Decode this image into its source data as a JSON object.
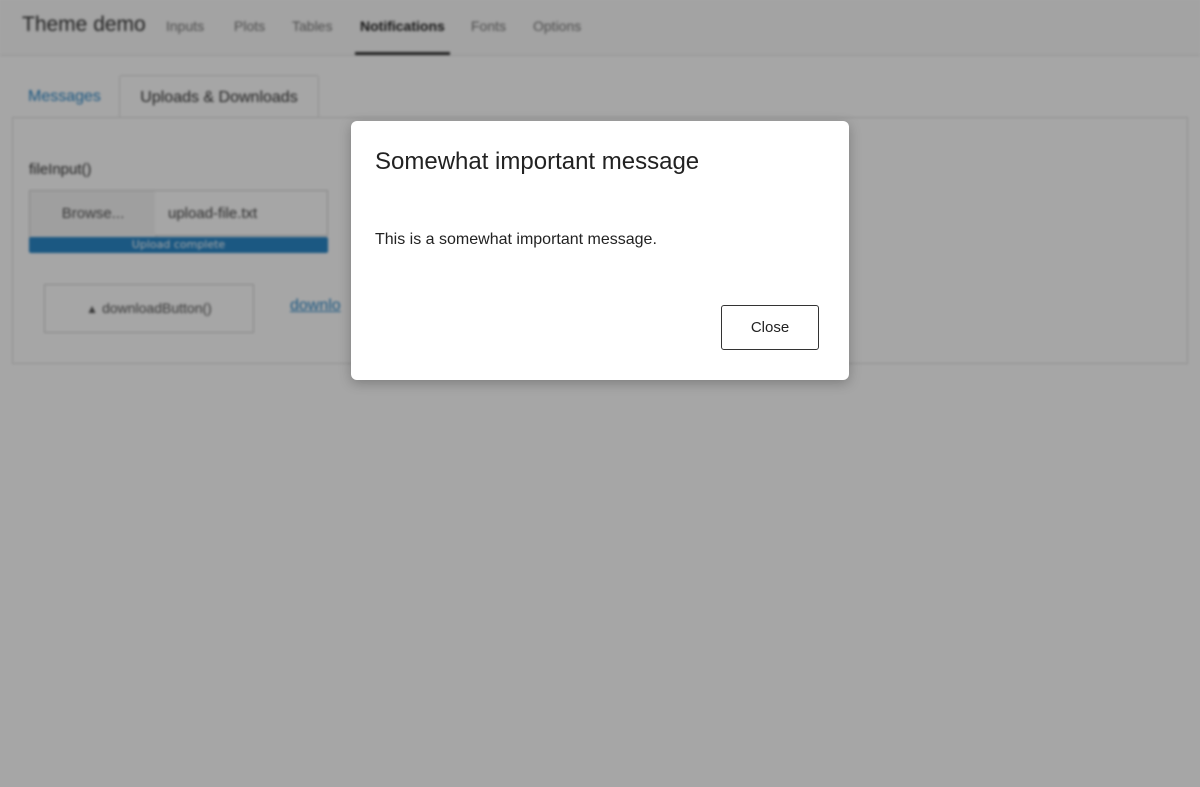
{
  "navbar": {
    "brand": "Theme demo",
    "items": [
      "Inputs",
      "Plots",
      "Tables",
      "Notifications",
      "Fonts",
      "Options"
    ],
    "active": "Notifications"
  },
  "subtabs": {
    "items": [
      "Messages",
      "Uploads & Downloads"
    ],
    "active": "Uploads & Downloads"
  },
  "upload": {
    "label": "fileInput()",
    "browse_label": "Browse...",
    "file_name": "upload-file.txt",
    "progress_text": "Upload complete",
    "progress_fraction": 1.0
  },
  "download": {
    "button_label": "downloadButton()",
    "link_text": "downlo"
  },
  "modal": {
    "title": "Somewhat important message",
    "body": "This is a somewhat important message.",
    "close_label": "Close"
  },
  "colors": {
    "accent": "#2a87c8",
    "backdrop": "rgba(0,0,0,0.35)"
  }
}
